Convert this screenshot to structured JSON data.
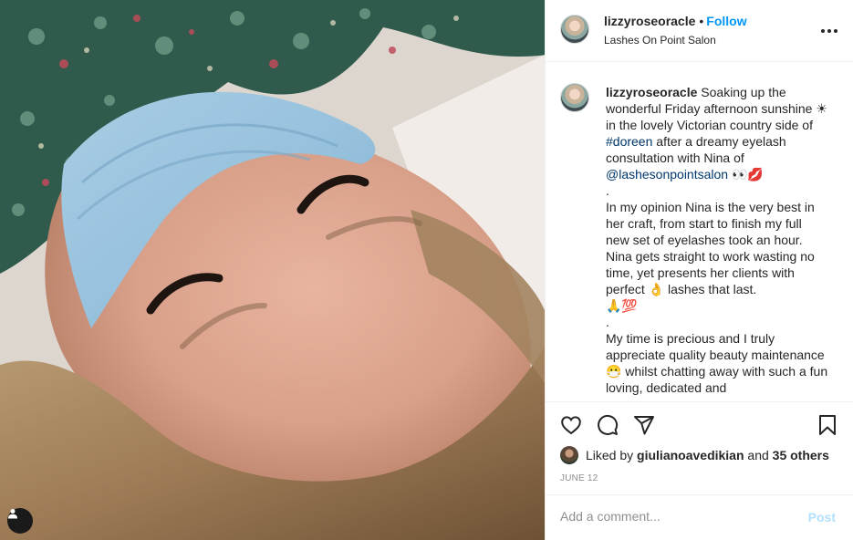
{
  "post": {
    "username": "lizzyroseoracle",
    "follow_label": "Follow",
    "separator": "•",
    "location": "Lashes On Point Salon",
    "caption": {
      "username": "lizzyroseoracle",
      "line1_a": " Soaking up the wonderful Friday afternoon sunshine ☀ in the lovely Victorian country side of ",
      "hashtag": "#doreen",
      "line1_b": " after a dreamy eyelash consultation with Nina of ",
      "mention": "@lashesonpointsalon",
      "line1_c": " 👀💋",
      "dot1": ".",
      "para2": "In my opinion Nina is the very best in her craft, from start to finish my full new set of eyelashes took an hour. Nina gets straight to work wasting no time, yet presents her clients with perfect 👌 lashes that last.",
      "emojis2": "🙏💯",
      "dot2": ".",
      "para3": "My time is precious and I truly appreciate quality beauty maintenance 😷 whilst chatting away with such a fun loving, dedicated and"
    },
    "likes": {
      "prefix": "Liked by ",
      "liker": "giulianoavedikian",
      "middle": " and ",
      "count": "35 others"
    },
    "date": "JUNE 12",
    "comment_placeholder": "Add a comment...",
    "post_label": "Post"
  },
  "icons": {
    "like": "heart-icon",
    "comment": "comment-icon",
    "share": "paper-plane-icon",
    "save": "bookmark-icon",
    "more": "more-options-icon",
    "tags": "user-tag-icon"
  },
  "colors": {
    "accent": "#0095f6",
    "link": "#00376b",
    "post_disabled": "#b2dffc",
    "muted": "#8e8e8e"
  }
}
